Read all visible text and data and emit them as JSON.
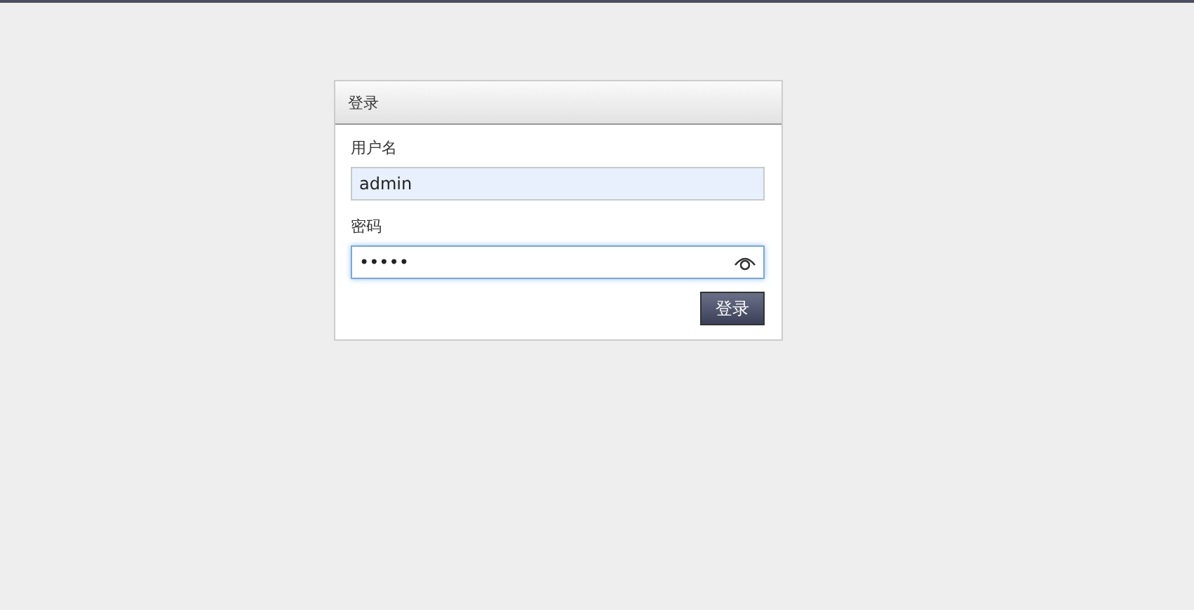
{
  "panel": {
    "title": "登录"
  },
  "fields": [
    {
      "kind": "text",
      "label": "用户名",
      "value": "admin",
      "focused": false,
      "autofilled": true
    },
    {
      "kind": "password",
      "label": "密码",
      "value": "•••••",
      "focused": true,
      "autofilled": false
    }
  ],
  "submit": {
    "label": "登录"
  }
}
